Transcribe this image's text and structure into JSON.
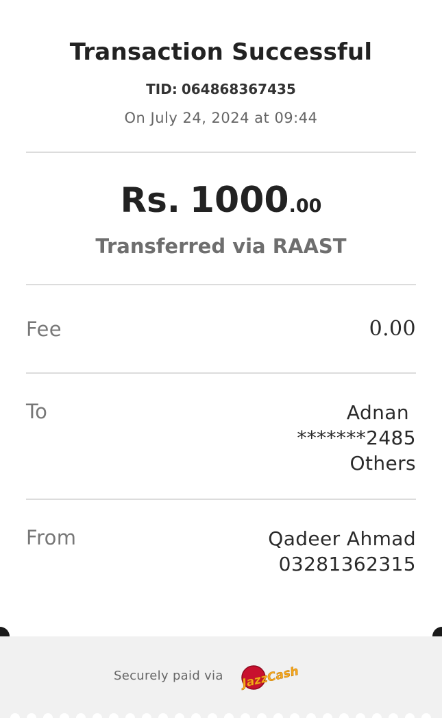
{
  "receipt": {
    "title": "Transaction Successful",
    "tid_label": "TID:",
    "tid_value": "064868367435",
    "datetime": "On July 24, 2024 at 09:44",
    "amount": {
      "currency": "Rs.",
      "major": "1000",
      "minor": ".00"
    },
    "method": "Transferred via RAAST",
    "fee": {
      "label": "Fee",
      "value": "0.00"
    },
    "to": {
      "label": "To",
      "name": "Adnan",
      "account": "*******2485",
      "bank": "Others"
    },
    "from": {
      "label": "From",
      "name": "Qadeer Ahmad",
      "account": "03281362315"
    }
  },
  "footer": {
    "secure_text": "Securely paid via",
    "logo": {
      "icon": "jazzcash-logo",
      "text": "JazzCash"
    }
  },
  "colors": {
    "text_dark": "#222222",
    "text_muted": "#777777",
    "divider": "#dcdcdc",
    "footer_bg": "#f1f1f1",
    "brand_red": "#c8102e",
    "brand_orange": "#f7a81b"
  }
}
